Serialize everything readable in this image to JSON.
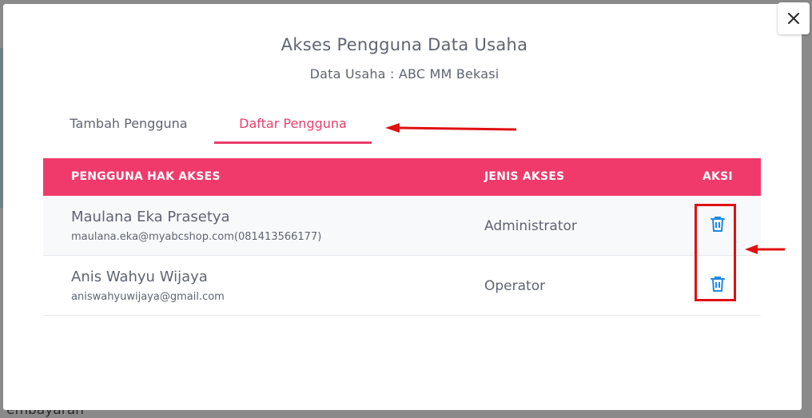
{
  "background": {
    "partial_text": "embayaran"
  },
  "modal": {
    "title": "Akses Pengguna Data Usaha",
    "subtitle": "Data Usaha : ABC MM Bekasi",
    "close_icon": "close-icon"
  },
  "tabs": [
    {
      "label": "Tambah Pengguna",
      "active": false
    },
    {
      "label": "Daftar Pengguna",
      "active": true
    }
  ],
  "table": {
    "headers": {
      "user": "PENGGUNA HAK AKSES",
      "type": "JENIS AKSES",
      "action": "AKSI"
    },
    "rows": [
      {
        "name": "Maulana Eka Prasetya",
        "contact": "maulana.eka@myabcshop.com(081413566177)",
        "access": "Administrator",
        "action_icon": "trash-icon"
      },
      {
        "name": "Anis Wahyu Wijaya",
        "contact": "aniswahyuwijaya@gmail.com",
        "access": "Operator",
        "action_icon": "trash-icon"
      }
    ]
  },
  "colors": {
    "accent": "#ef3a6b",
    "annotation": "#e01010",
    "icon": "#1e88e5"
  }
}
